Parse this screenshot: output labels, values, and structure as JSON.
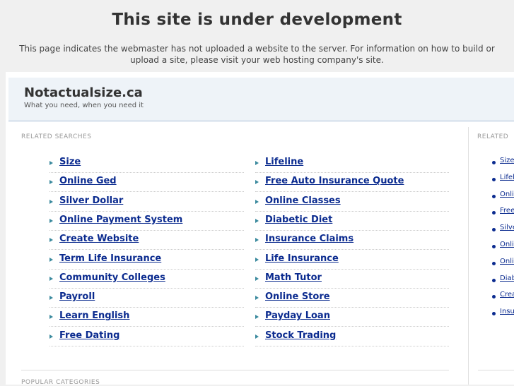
{
  "notice": {
    "title": "This site is under development",
    "message": "This page indicates the webmaster has not uploaded a website to the server. For information on how to build or upload a site, please visit your web hosting company's site."
  },
  "site": {
    "name": "Notactualsize.ca",
    "tagline": "What you need, when you need it"
  },
  "related_searches": {
    "label": "RELATED SEARCHES",
    "left": [
      "Size",
      "Online Ged",
      "Silver Dollar",
      "Online Payment System",
      "Create Website",
      "Term Life Insurance",
      "Community Colleges",
      "Payroll",
      "Learn English",
      "Free Dating"
    ],
    "right": [
      "Lifeline",
      "Free Auto Insurance Quote",
      "Online Classes",
      "Diabetic Diet",
      "Insurance Claims",
      "Life Insurance",
      "Math Tutor",
      "Online Store",
      "Payday Loan",
      "Stock Trading"
    ]
  },
  "sidebar": {
    "label": "RELATED",
    "items": [
      "Size",
      "Lifeline",
      "Online Ged",
      "Free Auto Insurance Quote",
      "Silver Dollar",
      "Online Classes",
      "Online Payment System",
      "Diabetic Diet",
      "Create Website",
      "Insurance Claims"
    ]
  },
  "popular": {
    "label": "POPULAR CATEGORIES"
  }
}
